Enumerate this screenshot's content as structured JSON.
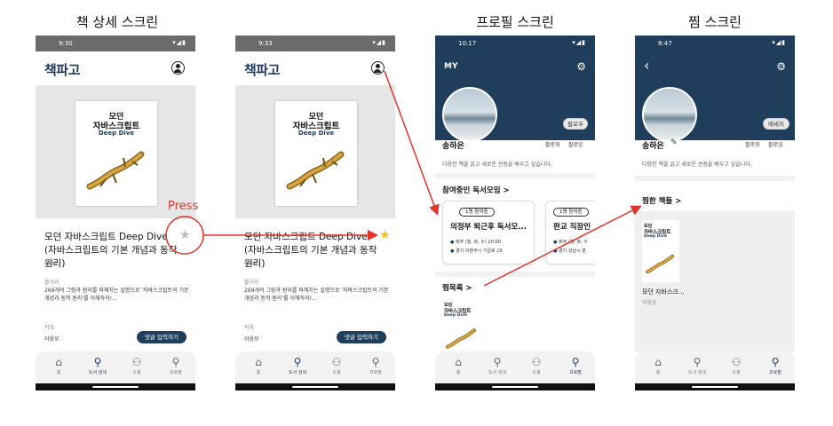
{
  "labels": {
    "detail": "책 상세 스크린",
    "profile": "프로필 스크린",
    "wish": "찜 스크린"
  },
  "annotation": {
    "press": "Press"
  },
  "accent_color": "#1f3e5c",
  "arrow_color": "#e4332a",
  "brand": "책파고",
  "book": {
    "cover_line1": "모던",
    "cover_line2": "자바스크립트",
    "cover_line3": "Deep Dive",
    "title": "모던 자바스크립트 Deep Dive (자바스크립트의 기본 개념과 동작 원리)",
    "author": "이웅모",
    "summary_label": "줄거리",
    "summary": "269개의 그림과 원리를 파헤치는 설명으로 '자바스크립트의 기본 개념과 동작 원리'를 이해하자!...",
    "writer_label": "저자",
    "writer": "이웅모",
    "comment_button": "댓글 입력하기",
    "star_empty": "★",
    "star_filled": "★"
  },
  "screens": {
    "detail1": {
      "time": "9:30"
    },
    "detail2": {
      "time": "9:33"
    },
    "profile": {
      "time": "10:17"
    },
    "wish": {
      "time": "8:47"
    }
  },
  "status_icons": "▾◢▮",
  "nav": [
    {
      "icon": "home-icon",
      "glyph": "⌂",
      "label": "홈"
    },
    {
      "icon": "search-icon",
      "glyph": "⚲",
      "label": "도서 검색"
    },
    {
      "icon": "group-icon",
      "glyph": "⚇",
      "label": "소셜"
    },
    {
      "icon": "person-icon",
      "glyph": "⚲",
      "label": "프로필"
    }
  ],
  "profile": {
    "header": "MY",
    "follow_button": "팔로우",
    "message_button": "메세지",
    "name": "송하은",
    "followers": "팔로워",
    "following": "팔로잉",
    "bio": "다양한 책을 읽고 새로운 관점을 배우고 싶습니다.",
    "clubs_title": "참여중인 독서모임 >",
    "wish_title": "찜목록 >",
    "wished_books_title": "찜한 책들 >",
    "club1": {
      "tag": "1명 참여중",
      "name": "의정부 퇴근후 독서모...",
      "schedule": "매주 (월, 화, 수) 20:00",
      "place": "경기 의정부시 가금로 29"
    },
    "club2": {
      "tag": "1명 참여중",
      "name": "판교 직장인",
      "schedule": "매주 (월, 화, 수",
      "place": "경기 성남시 분"
    },
    "wish_book_title": "모던 자바스크...",
    "wish_book_author": "이웅모"
  }
}
